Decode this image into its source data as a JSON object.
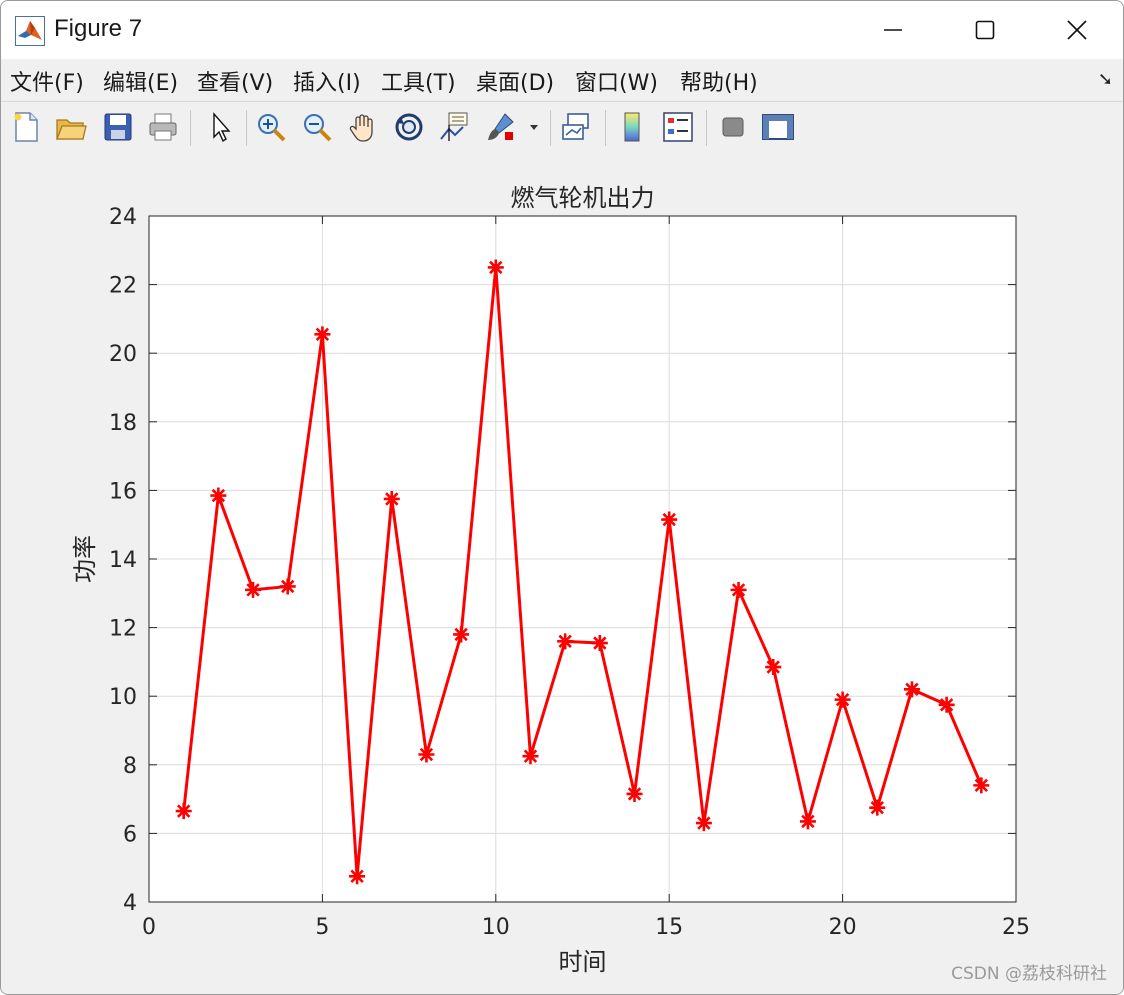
{
  "window": {
    "title": "Figure 7",
    "controls": {
      "minimize": "—",
      "maximize": "☐",
      "close": "✕"
    }
  },
  "menu": [
    {
      "label": "文件(F)"
    },
    {
      "label": "编辑(E)"
    },
    {
      "label": "查看(V)"
    },
    {
      "label": "插入(I)"
    },
    {
      "label": "工具(T)"
    },
    {
      "label": "桌面(D)"
    },
    {
      "label": "窗口(W)"
    },
    {
      "label": "帮助(H)"
    }
  ],
  "toolbar": {
    "icons": [
      "new-figure-icon",
      "open-file-icon",
      "save-icon",
      "print-icon",
      "edit-plot-arrow-icon",
      "zoom-in-icon",
      "zoom-out-icon",
      "pan-hand-icon",
      "rotate-3d-icon",
      "data-cursor-icon",
      "brush-icon",
      "link-plot-icon",
      "colorbar-icon",
      "legend-icon",
      "hide-plot-tools-icon",
      "show-plot-tools-icon"
    ]
  },
  "watermark": "CSDN @荔枝科研社",
  "chart_data": {
    "type": "line",
    "title": "燃气轮机出力",
    "xlabel": "时间",
    "ylabel": "功率",
    "xlim": [
      0,
      25
    ],
    "ylim": [
      4,
      24
    ],
    "xticks": [
      0,
      5,
      10,
      15,
      20,
      25
    ],
    "yticks": [
      4,
      6,
      8,
      10,
      12,
      14,
      16,
      18,
      20,
      22,
      24
    ],
    "grid": true,
    "series": [
      {
        "color": "#ff0000",
        "marker": "asterisk",
        "x": [
          1,
          2,
          3,
          4,
          5,
          6,
          7,
          8,
          9,
          10,
          11,
          12,
          13,
          14,
          15,
          16,
          17,
          18,
          19,
          20,
          21,
          22,
          23,
          24
        ],
        "y": [
          6.65,
          15.85,
          13.1,
          13.2,
          20.55,
          4.75,
          15.75,
          8.3,
          11.8,
          22.5,
          8.25,
          11.6,
          11.55,
          7.15,
          15.15,
          6.3,
          13.1,
          10.85,
          6.35,
          9.9,
          6.75,
          10.2,
          9.75,
          7.4
        ]
      }
    ]
  }
}
